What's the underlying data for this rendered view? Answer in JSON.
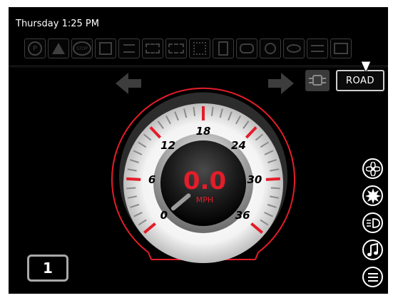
{
  "status_bar": {
    "time": "Thursday 1:25 PM",
    "tell_tales": [
      {
        "icon": "park-brake-icon",
        "text": "P"
      },
      {
        "icon": "warning-icon",
        "text": "!"
      },
      {
        "icon": "stop-icon",
        "text": "STOP"
      },
      {
        "icon": "transmission-warning-icon",
        "text": ""
      },
      {
        "icon": "coolant-temp-icon",
        "text": ""
      },
      {
        "icon": "battery-charge-icon",
        "text": ""
      },
      {
        "icon": "engine-fault-icon",
        "text": ""
      },
      {
        "icon": "emissions-icon",
        "text": ""
      },
      {
        "icon": "fuel-level-icon",
        "text": ""
      },
      {
        "icon": "oil-pressure-icon",
        "text": ""
      },
      {
        "icon": "oil-temp-icon",
        "text": ""
      },
      {
        "icon": "oil-can-icon",
        "text": ""
      },
      {
        "icon": "brake-system-icon",
        "text": ""
      }
    ]
  },
  "drive_mode": {
    "label": "ROAD"
  },
  "speedometer": {
    "speed": "0.0",
    "unit": "MPH",
    "value": 0,
    "min": 0,
    "max": 36,
    "tick_labels": [
      "0",
      "6",
      "12",
      "18",
      "24",
      "30",
      "36"
    ]
  },
  "gear": {
    "value": "1"
  },
  "side_menu": [
    {
      "icon": "fan-icon"
    },
    {
      "icon": "lights-brightness-icon"
    },
    {
      "icon": "headlight-icon"
    },
    {
      "icon": "music-note-icon"
    },
    {
      "icon": "menu-icon"
    }
  ],
  "colors": {
    "accent": "#e31d2a",
    "background": "#000000"
  }
}
